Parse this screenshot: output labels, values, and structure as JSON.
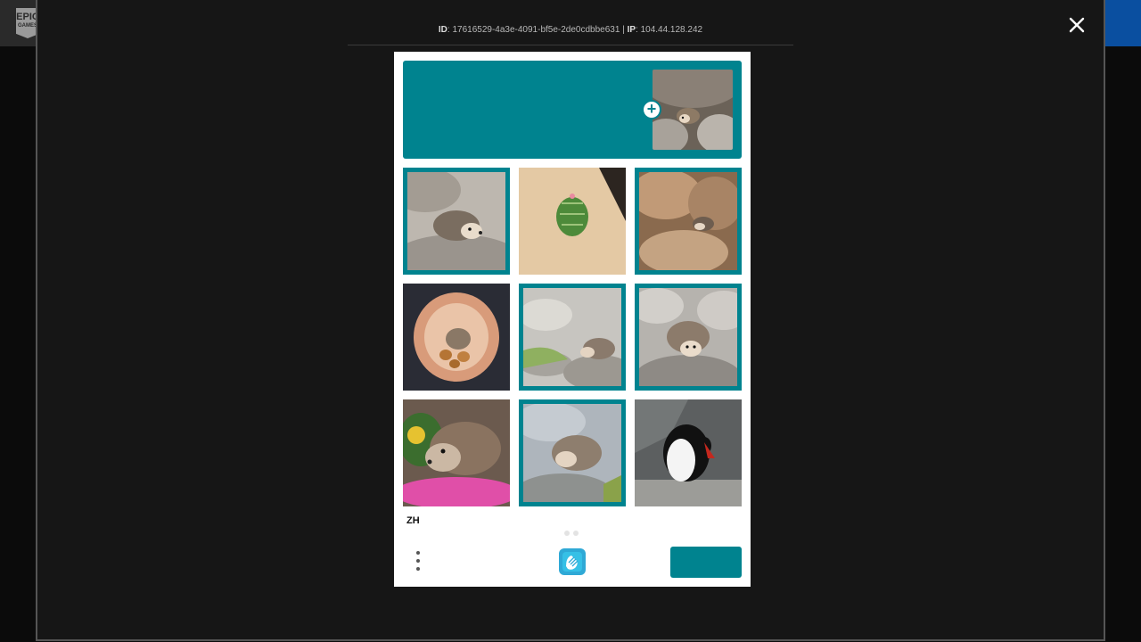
{
  "topbar": {
    "logo_line1": "EPIC",
    "logo_line2": "GAMES"
  },
  "session": {
    "id_label": "ID",
    "id_value": ": 17616529-4a3e-4091-bf5e-2de0cdbbe631 | ",
    "ip_label": "IP",
    "ip_value": ": 104.44.128.242"
  },
  "captcha": {
    "prompt_title": "",
    "prompt_sub": "",
    "language": "ZH",
    "report_label": "",
    "submit_label": "",
    "accent_color": "#00838f",
    "tiles": [
      {
        "subject": "hedgehog-on-rocks",
        "selected": true
      },
      {
        "subject": "cactus-in-sand",
        "selected": false
      },
      {
        "subject": "hedgehog-between-rocks",
        "selected": true
      },
      {
        "subject": "hedgehog-in-pot",
        "selected": false
      },
      {
        "subject": "hedgehog-on-stone",
        "selected": true
      },
      {
        "subject": "hedgehog-on-boulder",
        "selected": true
      },
      {
        "subject": "hedgehog-with-flowers",
        "selected": false
      },
      {
        "subject": "hedgehog-on-pebbles",
        "selected": true
      },
      {
        "subject": "penguin",
        "selected": false
      }
    ]
  }
}
